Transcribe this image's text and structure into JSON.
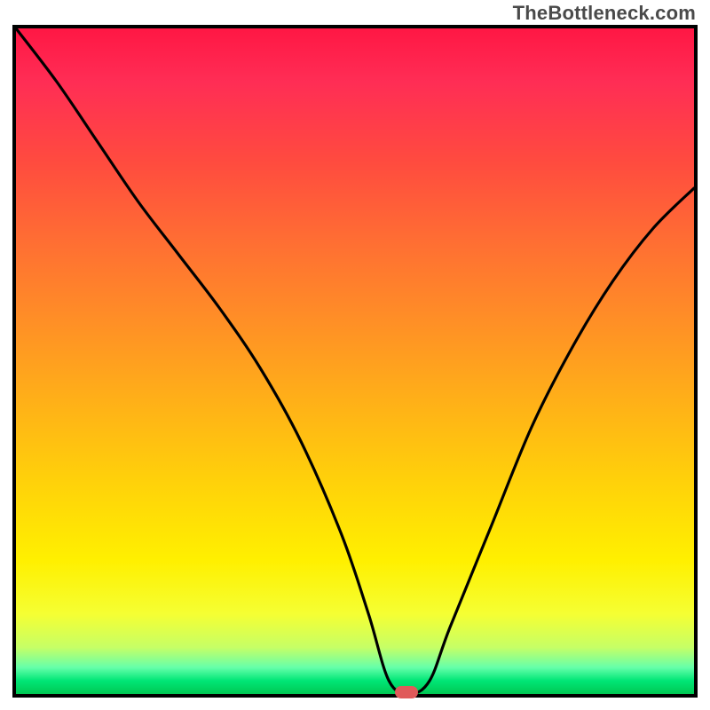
{
  "watermark": "TheBottleneck.com",
  "chart_data": {
    "type": "line",
    "title": "",
    "xlabel": "",
    "ylabel": "",
    "xlim": [
      0,
      100
    ],
    "ylim": [
      0,
      100
    ],
    "grid": false,
    "legend": false,
    "series": [
      {
        "name": "bottleneck-curve",
        "x": [
          0,
          6,
          12,
          18,
          24,
          30,
          36,
          42,
          48,
          52,
          55,
          58,
          61,
          64,
          70,
          76,
          82,
          88,
          94,
          100
        ],
        "y": [
          100,
          92,
          83,
          74,
          66,
          58,
          49,
          38,
          24,
          12,
          2,
          0,
          2,
          10,
          25,
          40,
          52,
          62,
          70,
          76
        ]
      }
    ],
    "annotations": [
      {
        "name": "optimal-marker",
        "x": 57,
        "y": 0,
        "shape": "pill",
        "color": "#e05a5a"
      }
    ],
    "background_gradient": {
      "direction": "vertical",
      "stops": [
        {
          "pos": 0.0,
          "color": "#ff1744"
        },
        {
          "pos": 0.8,
          "color": "#fff000"
        },
        {
          "pos": 1.0,
          "color": "#00c853"
        }
      ]
    }
  }
}
